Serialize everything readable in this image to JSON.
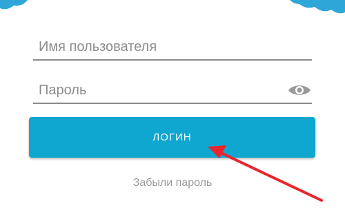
{
  "form": {
    "username_placeholder": "Имя пользователя",
    "username_value": "",
    "password_placeholder": "Пароль",
    "password_value": ""
  },
  "actions": {
    "login_label": "ЛОГИН",
    "forgot_password_label": "Забыли пароль"
  },
  "icons": {
    "password_visibility": "eye-icon",
    "annotation": "red-arrow-icon"
  },
  "colors": {
    "accent": "#0fa6d0",
    "header_cloud": "#2ea7d8",
    "field_underline": "#8a8a8a",
    "placeholder": "#8c8c8c",
    "link": "#9a9a9a",
    "annotation_arrow": "#e8262f"
  }
}
